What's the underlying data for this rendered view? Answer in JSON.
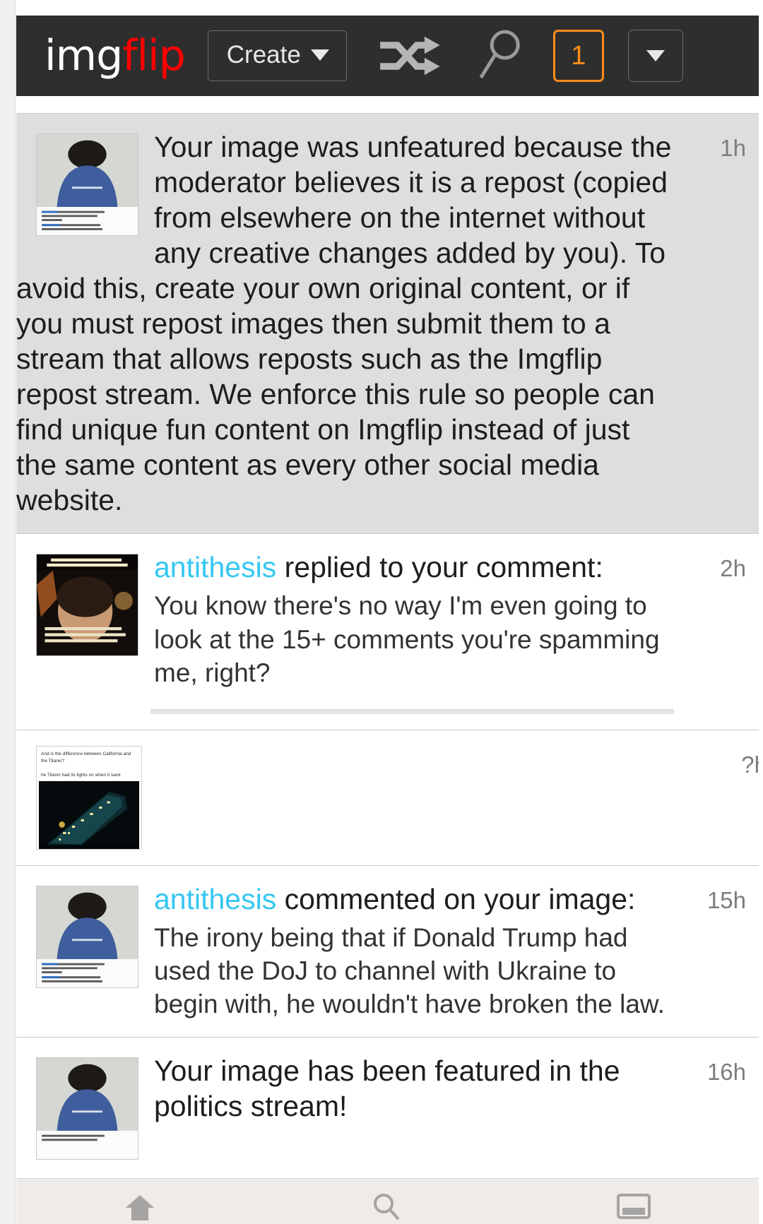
{
  "navbar": {
    "logo_first": "img",
    "logo_second": "flip",
    "create_label": "Create",
    "shuffle_icon": "shuffle-icon",
    "search_icon": "search-icon",
    "notification_count": "1",
    "menu_icon": "chevron-down-icon",
    "background_color": "#2e2e2e",
    "accent_color": "#ff8c1a",
    "logo_accent_color": "#ff0000"
  },
  "notifications": [
    {
      "id": "unfeatured-notice",
      "unread": true,
      "thumbnail": "blue-shirt-man-meme-thumbnail",
      "title": "",
      "user": "",
      "text": "Your image was unfeatured because the moderator believes it is a repost (copied from elsewhere on the internet without any creative changes added by you). To avoid this, create your own original content, or if you must repost images then submit them to a stream that allows reposts such as the Imgflip repost stream. We enforce this rule so people can find unique fun content on Imgflip instead of just the same content as every other social media website.",
      "time": "1h"
    },
    {
      "id": "reply-notice",
      "unread": false,
      "thumbnail": "matrix-movie-meme-thumbnail",
      "user": "antithesis",
      "title": " replied to your comment:",
      "text": "You know there's no way I'm even going to look at the 15+ comments you're spamming me, right?",
      "time": "2h"
    },
    {
      "id": "titanic-notice",
      "unread": false,
      "thumbnail": "titanic-meme-thumbnail",
      "thumb_caption_1": "And is the difference between California and the Titanic?",
      "thumb_caption_2": "he Titanic had its lights on when it sank",
      "user": "",
      "title": "",
      "text": "",
      "time": "?h"
    },
    {
      "id": "comment-notice",
      "unread": false,
      "thumbnail": "blue-shirt-man-meme-thumbnail",
      "user": "antithesis",
      "title": " commented on your image:",
      "text": "The irony being that if Donald Trump had used the DoJ to channel with Ukraine to begin with, he wouldn't have broken the law.",
      "time": "15h"
    },
    {
      "id": "featured-notice",
      "unread": false,
      "thumbnail": "blue-shirt-man-meme-thumbnail",
      "user": "",
      "title": "",
      "text": "Your image has been featured in the politics stream!",
      "time": "16h"
    }
  ],
  "bottom_bar": {
    "items": [
      "home-icon",
      "search-icon",
      "gallery-icon"
    ]
  }
}
